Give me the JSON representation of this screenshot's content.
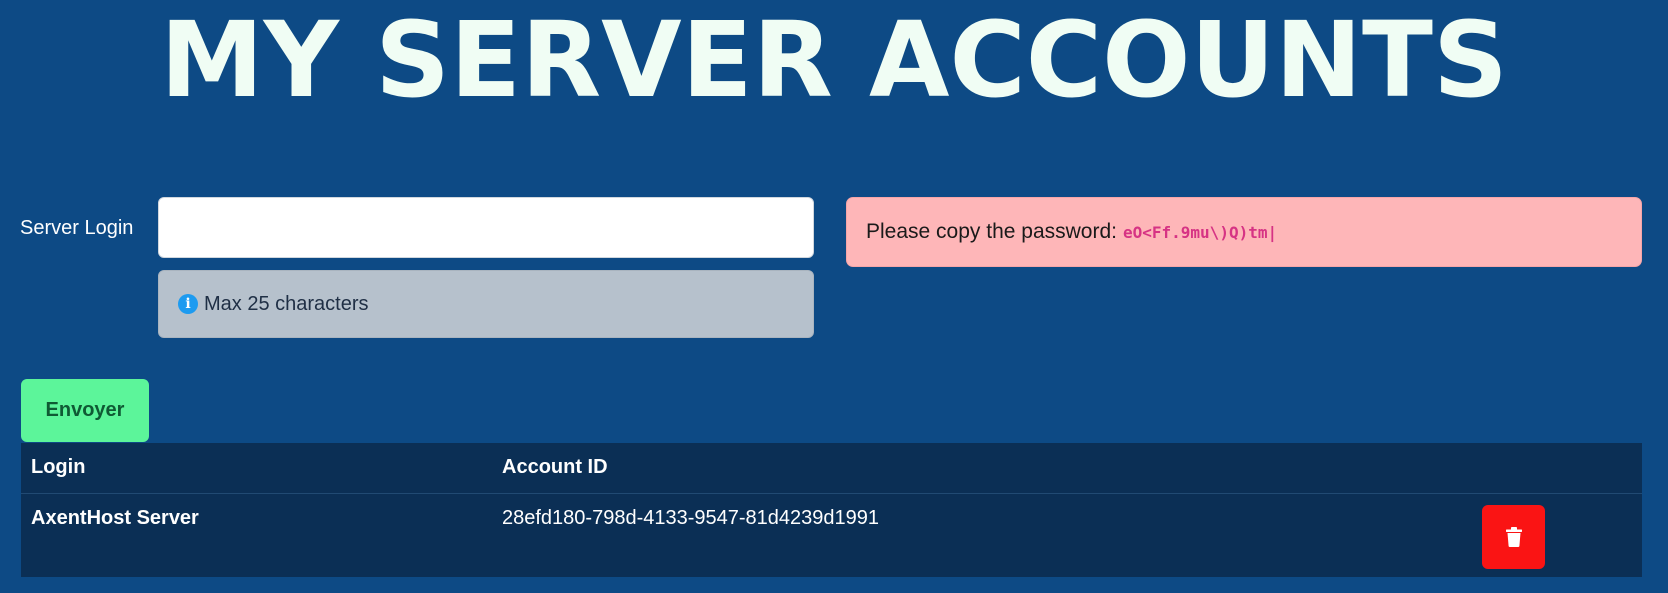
{
  "header": {
    "title": "MY SERVER ACCOUNTS"
  },
  "form": {
    "login_label": "Server Login",
    "login_value": "",
    "login_placeholder": "",
    "hint_icon": "info-icon",
    "hint_text": "Max 25 characters",
    "submit_label": "Envoyer"
  },
  "alert": {
    "message": "Please copy the password:",
    "password": "eO<Ff.9mu\\)Q)tm|"
  },
  "table": {
    "headers": [
      "Login",
      "Account ID",
      ""
    ],
    "rows": [
      {
        "login": "AxentHost Server",
        "account_id": "28efd180-798d-4133-9547-81d4239d1991",
        "action_icon": "trash-icon"
      }
    ]
  },
  "colors": {
    "background": "#0d4a85",
    "title": "#f0fdf4",
    "alert_background": "#feb6b8",
    "password_text": "#d63384",
    "hint_background": "#b6c1cc",
    "submit_background": "#5cf59a",
    "table_background": "#0b2f55",
    "delete_background": "#fa1414"
  }
}
